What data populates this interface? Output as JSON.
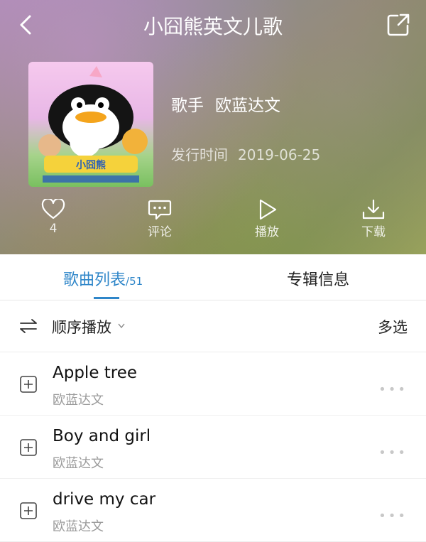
{
  "header": {
    "title": "小囧熊英文儿歌",
    "artist_label": "歌手",
    "artist_value": "欧蓝达文",
    "release_label": "发行时间",
    "release_value": "2019-06-25"
  },
  "actions": [
    {
      "label": "4",
      "icon": "heart-icon"
    },
    {
      "label": "评论",
      "icon": "comment-icon"
    },
    {
      "label": "播放",
      "icon": "play-icon"
    },
    {
      "label": "下载",
      "icon": "download-icon"
    }
  ],
  "tabs": {
    "songs_label": "歌曲列表",
    "songs_count": "/51",
    "info_label": "专辑信息",
    "active_color": "#2f86c9"
  },
  "mode": {
    "label": "顺序播放",
    "multi_select": "多选"
  },
  "songs": [
    {
      "title": "Apple tree",
      "artist": "欧蓝达文"
    },
    {
      "title": "Boy and girl",
      "artist": "欧蓝达文"
    },
    {
      "title": "drive my car",
      "artist": "欧蓝达文"
    }
  ]
}
